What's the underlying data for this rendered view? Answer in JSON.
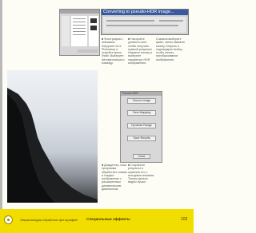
{
  "window": {
    "title": "Converting to pseudo-HDR image..."
  },
  "columns": {
    "c1": "■ Фотография с пейзажем. Загрузите ее в Photoshop и откройте меню Файл. Выберите Автоматизация и команду.",
    "c2": "■ Настройте уровни в окне, чтобы получить нужный результат. Нажмите кнопку и выберите параметры HDR изображения.",
    "c3": "Сначала выберите файл, затем нажмите кнопку Открыть и подтвердите выбор, чтобы начать преобразование изображения.",
    "c4": "■ Дождитесь, пока программа обработает снимок и создаст изображение с расширенным динамическим диапазоном.",
    "c5": "■ Сохраните результат и сравните его с исходным снимком. Теперь детали видны лучше."
  },
  "dialog": {
    "title": "Pseudo HDR",
    "buttons": [
      "Source Image",
      "Tone Mapping",
      "Dynamic Range",
      "Save Results"
    ],
    "ok": "Close"
  },
  "footer": {
    "left": "Энциклопедия обработки фотографий",
    "section": "Специальные эффекты",
    "page": "103"
  }
}
